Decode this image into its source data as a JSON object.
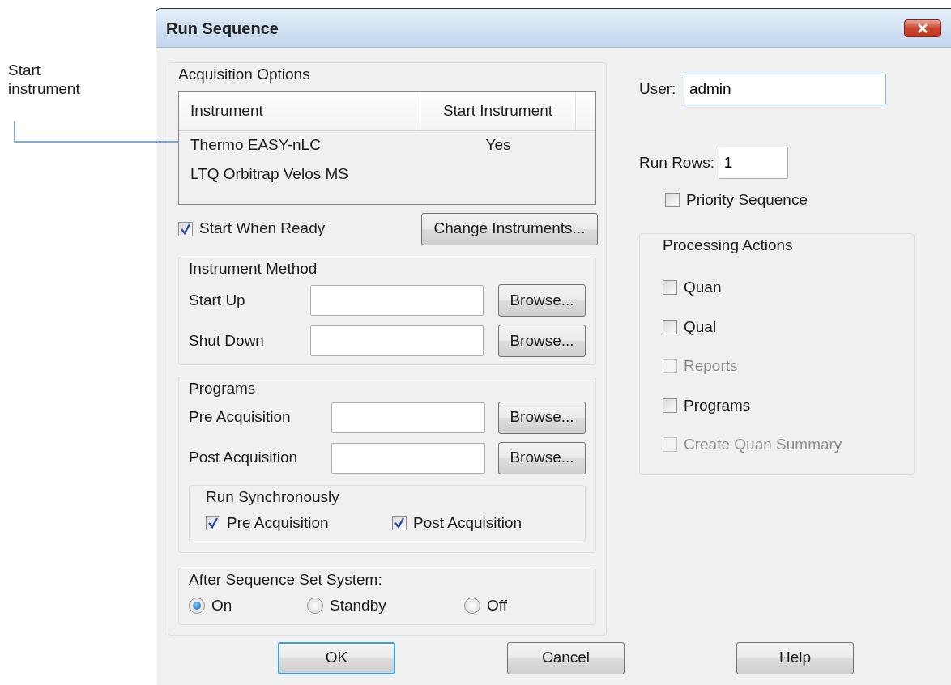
{
  "annotation": {
    "text": "Start instrument"
  },
  "window": {
    "title": "Run Sequence"
  },
  "acquisition_options": {
    "title": "Acquisition Options",
    "columns": [
      "Instrument",
      "Start Instrument"
    ],
    "rows": [
      {
        "instrument": "Thermo EASY-nLC",
        "start_instrument": "Yes"
      },
      {
        "instrument": "LTQ Orbitrap Velos MS"
      }
    ]
  },
  "start_when_ready": {
    "label": "Start When Ready",
    "checked": true
  },
  "change_instruments_button": "Change Instruments...",
  "instrument_method": {
    "title": "Instrument Method",
    "fields": [
      {
        "label": "Start Up",
        "button": "Browse..."
      },
      {
        "label": "Shut Down",
        "button": "Browse..."
      }
    ]
  },
  "programs": {
    "title": "Programs",
    "fields": [
      {
        "label": "Pre Acquisition",
        "button": "Browse..."
      },
      {
        "label": "Post Acquisition",
        "button": "Browse..."
      }
    ],
    "run_synchronously": {
      "title": "Run Synchronously",
      "options": [
        {
          "label": "Pre Acquisition",
          "checked": true
        },
        {
          "label": "Post Acquisition",
          "checked": true
        }
      ]
    }
  },
  "after_sequence": {
    "title": "After Sequence Set System:",
    "options": [
      {
        "label": "On",
        "selected": true
      },
      {
        "label": "Standby",
        "selected": false
      },
      {
        "label": "Off",
        "selected": false
      }
    ]
  },
  "user": {
    "label": "User:",
    "value": "admin"
  },
  "run_rows": {
    "label": "Run Rows:",
    "value": "1"
  },
  "priority_sequence": {
    "label": "Priority Sequence",
    "checked": false
  },
  "processing_actions": {
    "title": "Processing Actions",
    "items": [
      {
        "label": "Quan",
        "checked": false,
        "disabled": false
      },
      {
        "label": "Qual",
        "checked": false,
        "disabled": false
      },
      {
        "label": "Reports",
        "checked": false,
        "disabled": true
      },
      {
        "label": "Programs",
        "checked": false,
        "disabled": false
      },
      {
        "label": "Create Quan Summary",
        "checked": false,
        "disabled": true
      }
    ]
  },
  "buttons": [
    {
      "label": "OK",
      "default": true
    },
    {
      "label": "Cancel",
      "default": false
    },
    {
      "label": "Help",
      "default": false
    }
  ]
}
